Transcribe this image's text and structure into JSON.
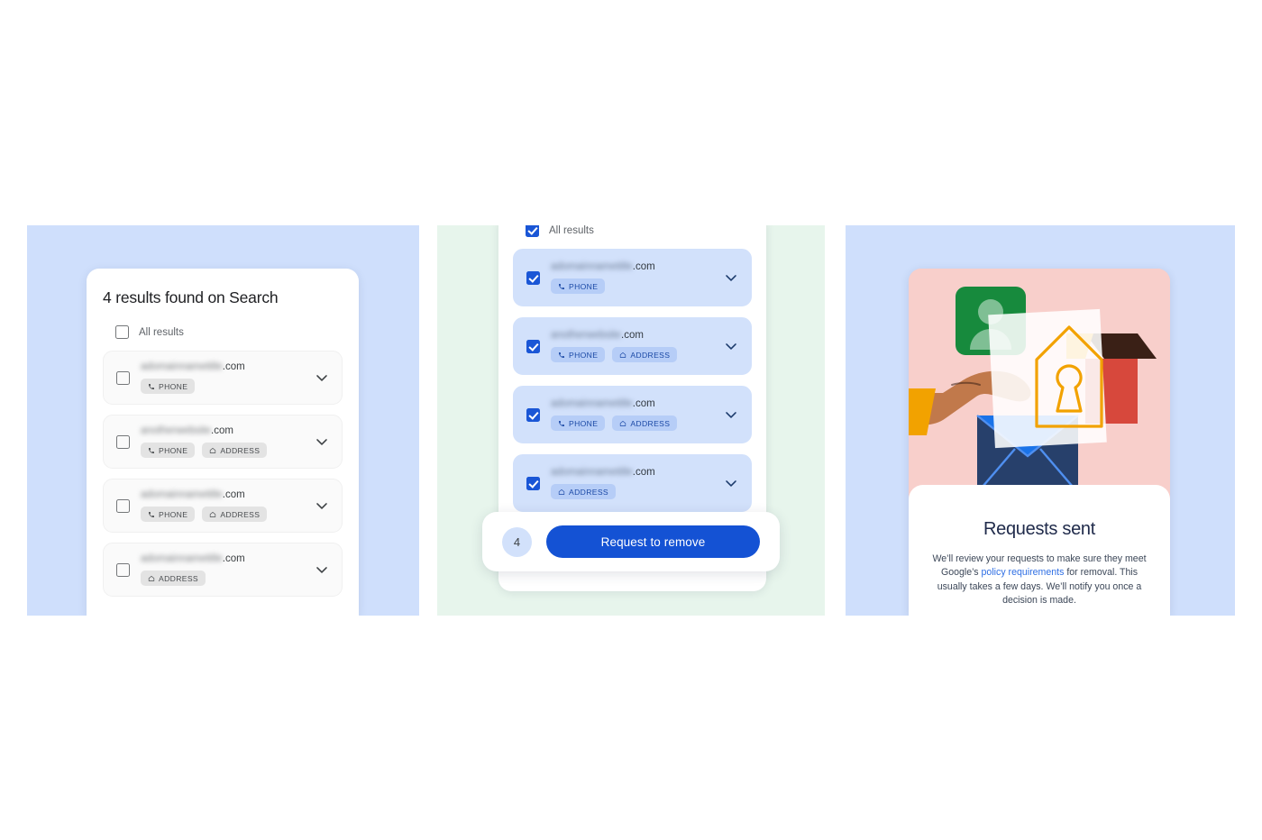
{
  "theme": {
    "panel_blue": "#cfdffc",
    "panel_green": "#e7f5ec",
    "accent_blue": "#1452d4",
    "checkbox_blue": "#1a56d6",
    "selected_row_blue": "#d2e1fb",
    "chip_grey": "#e3e3e3",
    "chip_blue": "#b6cdf7",
    "illustration_pink": "#f8cfcb",
    "illustration_green": "#178a3d",
    "illustration_red": "#d7483c",
    "illustration_orange": "#f2a200",
    "illustration_navy": "#27406b",
    "link_blue": "#2f6fe4"
  },
  "panel_one": {
    "name": "results-list-screen",
    "title": "4 results found on Search",
    "select_all": {
      "label": "All results",
      "checked": false
    },
    "results": [
      {
        "domain_blurred": "adomainnametitle",
        "domain_tld": ".com",
        "checked": false,
        "chips": [
          "PHONE"
        ]
      },
      {
        "domain_blurred": "anotherwebsite",
        "domain_tld": ".com",
        "checked": false,
        "chips": [
          "PHONE",
          "ADDRESS"
        ]
      },
      {
        "domain_blurred": "adomainnametitle",
        "domain_tld": ".com",
        "checked": false,
        "chips": [
          "PHONE",
          "ADDRESS"
        ]
      },
      {
        "domain_blurred": "adomainnametitle",
        "domain_tld": ".com",
        "checked": false,
        "chips": [
          "ADDRESS"
        ]
      }
    ]
  },
  "panel_two": {
    "name": "selected-results-screen",
    "select_all": {
      "label": "All results",
      "checked": true
    },
    "results": [
      {
        "domain_blurred": "adomainnametitle",
        "domain_tld": ".com",
        "checked": true,
        "chips": [
          "PHONE"
        ]
      },
      {
        "domain_blurred": "anotherwebsite",
        "domain_tld": ".com",
        "checked": true,
        "chips": [
          "PHONE",
          "ADDRESS"
        ]
      },
      {
        "domain_blurred": "adomainnametitle",
        "domain_tld": ".com",
        "checked": true,
        "chips": [
          "PHONE",
          "ADDRESS"
        ]
      },
      {
        "domain_blurred": "adomainnametitle",
        "domain_tld": ".com",
        "checked": true,
        "chips": [
          "ADDRESS"
        ]
      }
    ],
    "cta": {
      "count": "4",
      "button_label": "Request to remove"
    }
  },
  "panel_three": {
    "name": "requests-sent-screen",
    "illustration": {
      "name": "hand-holding-documents-illustration",
      "elements": [
        "profile-card-icon",
        "house-icon",
        "keyhole-document-icon",
        "envelope-icon",
        "hand-icon"
      ]
    },
    "title": "Requests sent",
    "body_part_1": "We’ll review your requests to make sure they meet Google’s ",
    "body_link": "policy requirements",
    "body_part_2": " for removal. This usually takes a few days. We’ll notify you once a decision is made."
  },
  "icons": {
    "phone": "phone-icon",
    "address": "home-icon",
    "expand": "chevron-down-icon",
    "check": "check-icon"
  }
}
